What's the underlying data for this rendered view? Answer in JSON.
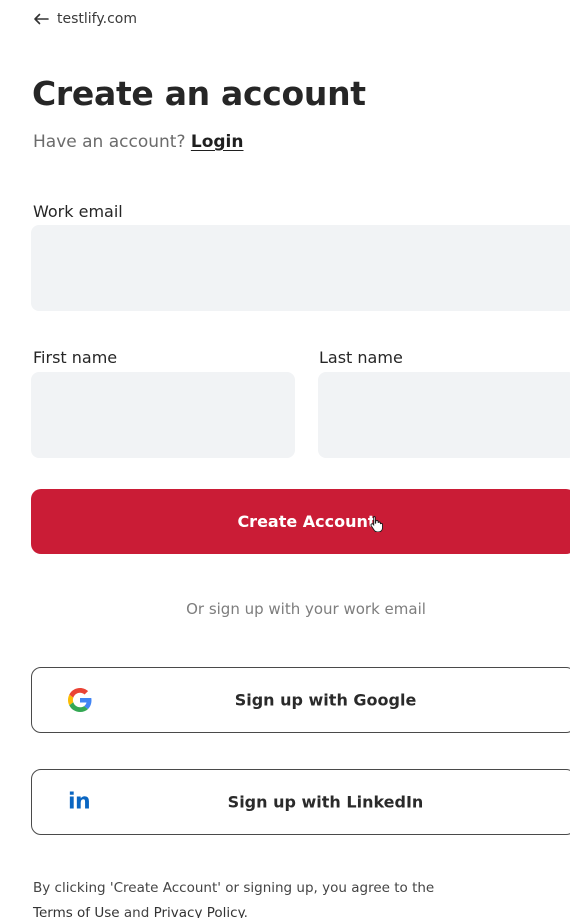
{
  "header": {
    "back_label": "testlify.com"
  },
  "page": {
    "title": "Create an account",
    "have_account_text": "Have an account?",
    "login_label": "Login"
  },
  "form": {
    "work_email_label": "Work email",
    "work_email_value": "",
    "first_name_label": "First name",
    "first_name_value": "",
    "last_name_label": "Last name",
    "last_name_value": "",
    "submit_label": "Create Account"
  },
  "social": {
    "divider_text": "Or sign up with your work email",
    "google_label": "Sign up with Google",
    "google_icon": "google-icon",
    "linkedin_label": "Sign up with LinkedIn",
    "linkedin_icon": "linkedin-icon",
    "linkedin_glyph": "in"
  },
  "legal": {
    "prefix": "By clicking 'Create Account' or signing up, you agree to the",
    "terms_label": "Terms of Use",
    "conjunction": "and",
    "privacy_label": "Privacy Policy",
    "suffix": "."
  },
  "colors": {
    "brand_red": "#ca1c36",
    "input_bg": "#f1f3f5",
    "linkedin_blue": "#0a66c2"
  }
}
